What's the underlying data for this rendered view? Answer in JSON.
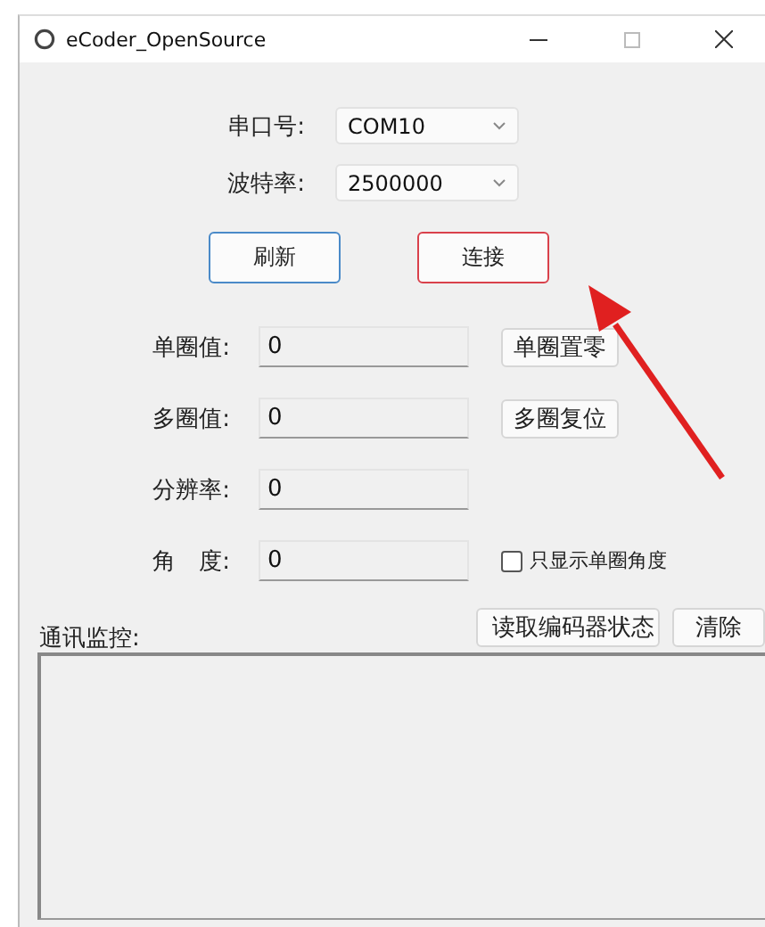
{
  "window": {
    "title": "eCoder_OpenSource"
  },
  "port": {
    "label": "串口号:",
    "value": "COM10"
  },
  "baud": {
    "label": "波特率:",
    "value": "2500000"
  },
  "buttons": [
    {
      "label": "刷新",
      "kind": "focused"
    },
    {
      "label": "连接",
      "kind": "highlighted"
    }
  ],
  "readings": [
    {
      "label": "单圈值:",
      "value": "0",
      "action": "单圈置零"
    },
    {
      "label": "多圈值:",
      "value": "0",
      "action": "多圈复位"
    },
    {
      "label": "分辨率:",
      "value": "0"
    },
    {
      "label": "角　度:",
      "value": "0",
      "option": {
        "label": "只显示单圈角度",
        "checked": false
      }
    }
  ],
  "monitor": {
    "label": "通讯监控:",
    "buttons": [
      "读取编码器状态",
      "清除"
    ]
  }
}
